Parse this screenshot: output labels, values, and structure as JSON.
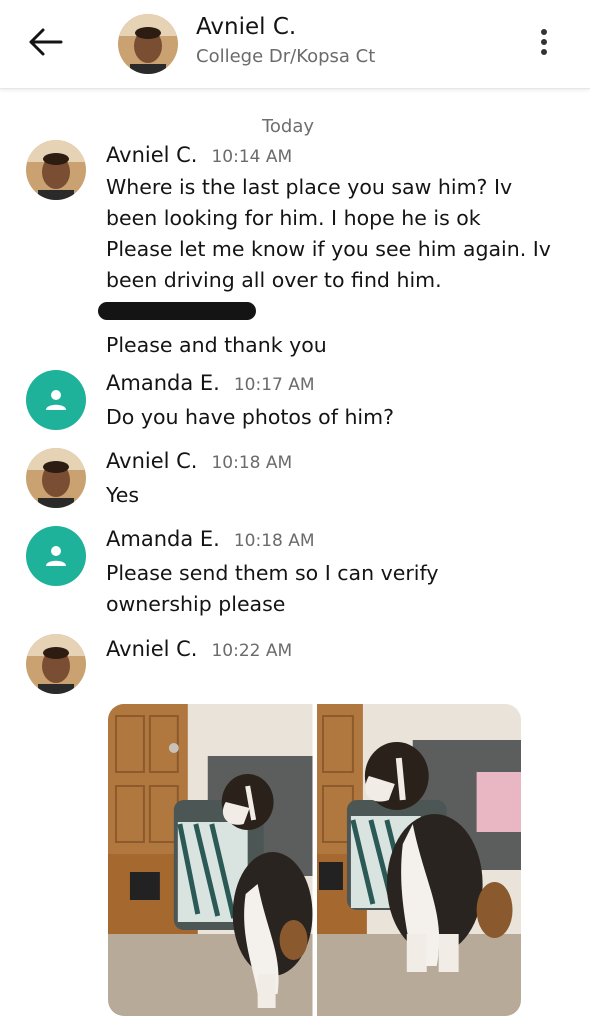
{
  "header": {
    "contact_name": "Avniel C.",
    "contact_subtitle": "College Dr/Kopsa Ct",
    "back_icon": "arrow-left-icon",
    "menu_icon": "more-vertical-icon"
  },
  "conversation": {
    "date_label": "Today",
    "messages": [
      {
        "sender": "Avniel C.",
        "time": "10:14 AM",
        "lines": [
          "Where is the last place you saw him? Iv",
          "been looking for him. I hope he is ok",
          "Please let me know if you see him again. Iv",
          "been driving all over to find him."
        ],
        "after_redaction": "Please and thank you"
      },
      {
        "sender": "Amanda E.",
        "time": "10:17 AM",
        "lines": [
          "Do you have photos of him?"
        ]
      },
      {
        "sender": "Avniel C.",
        "time": "10:18 AM",
        "lines": [
          "Yes"
        ]
      },
      {
        "sender": "Amanda E.",
        "time": "10:18 AM",
        "lines": [
          "Please send them so I can verify",
          "ownership please"
        ]
      },
      {
        "sender": "Avniel C.",
        "time": "10:22 AM",
        "lines": []
      }
    ]
  },
  "colors": {
    "generic_avatar": "#1eb29a",
    "redaction": "#141414"
  }
}
